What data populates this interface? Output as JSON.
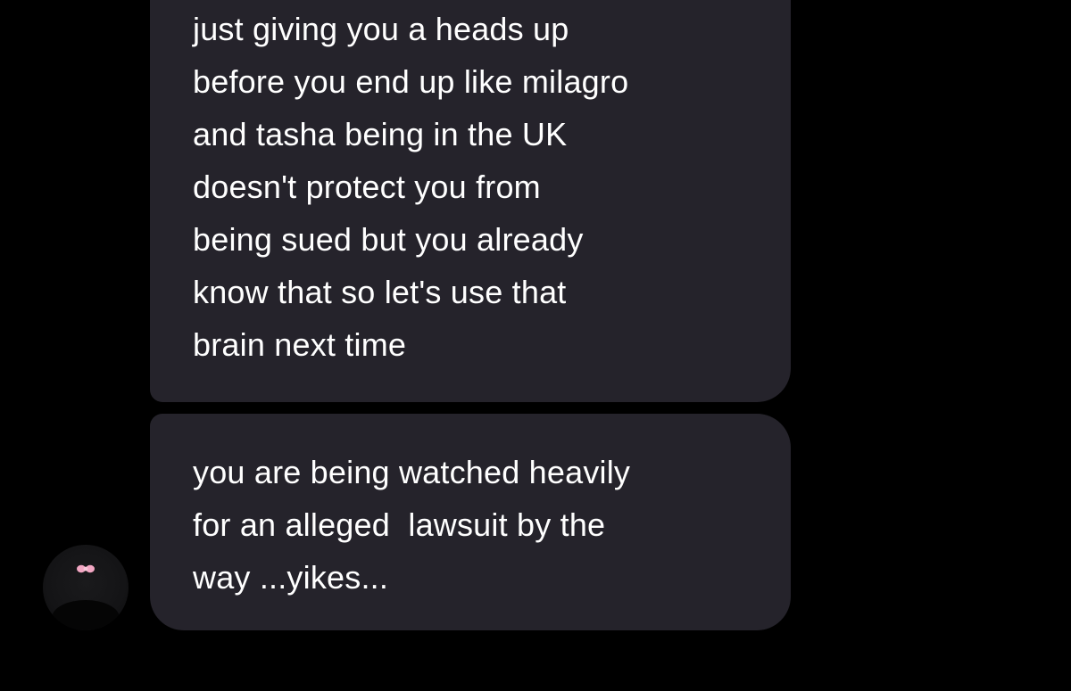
{
  "conversation": {
    "messages": [
      {
        "sender": "other",
        "lines": [
          "just giving you a heads up",
          "before you end up like milagro",
          "and tasha being in the UK",
          "doesn't protect you from",
          "being sued but you already",
          "know that so let's use that",
          "brain next time"
        ]
      },
      {
        "sender": "other",
        "lines": [
          "you are being watched heavily",
          "for an alleged  lawsuit by the",
          "way ...yikes..."
        ]
      }
    ],
    "avatar_icon": "bow-icon"
  },
  "colors": {
    "background": "#000000",
    "bubble": "#25232b",
    "text": "#ffffff",
    "bow": "#f2a7c3"
  }
}
